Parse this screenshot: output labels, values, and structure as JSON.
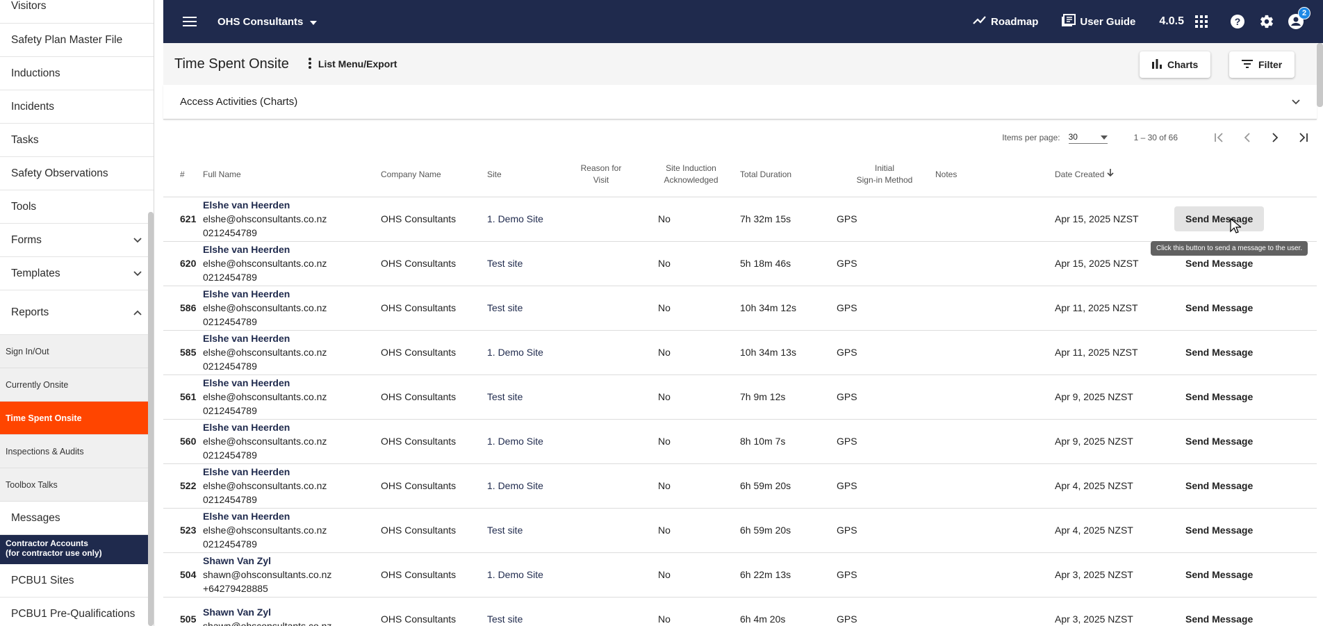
{
  "sidebar": {
    "items": [
      {
        "label": "Visitors"
      },
      {
        "label": "Safety Plan Master File"
      },
      {
        "label": "Inductions"
      },
      {
        "label": "Incidents"
      },
      {
        "label": "Tasks"
      },
      {
        "label": "Safety Observations"
      },
      {
        "label": "Tools"
      },
      {
        "label": "Forms"
      },
      {
        "label": "Templates"
      },
      {
        "label": "Reports"
      }
    ],
    "reports_sub": [
      {
        "label": "Sign In/Out"
      },
      {
        "label": "Currently Onsite"
      },
      {
        "label": "Time Spent Onsite"
      },
      {
        "label": "Inspections & Audits"
      },
      {
        "label": "Toolbox Talks"
      }
    ],
    "messages": "Messages",
    "contractor_banner_line1": "Contractor Accounts",
    "contractor_banner_line2": "(for contractor use only)",
    "contractor_items": [
      {
        "label": "PCBU1 Sites"
      },
      {
        "label": "PCBU1 Pre-Qualifications"
      }
    ]
  },
  "topbar": {
    "org_name": "OHS Consultants",
    "roadmap": "Roadmap",
    "user_guide": "User Guide",
    "version": "4.0.5",
    "notification_count": "2",
    "colors": {
      "bar": "#1f2a4d",
      "badge": "#1e88e5"
    }
  },
  "page": {
    "title": "Time Spent Onsite",
    "list_menu": "List Menu/Export",
    "charts_btn": "Charts",
    "filter_btn": "Filter",
    "accordion": "Access Activities (Charts)"
  },
  "paginator": {
    "items_per_page_label": "Items per page:",
    "items_per_page": "30",
    "range": "1 – 30 of 66"
  },
  "table": {
    "headers": {
      "num": "#",
      "full_name": "Full Name",
      "company": "Company Name",
      "site": "Site",
      "reason_1": "Reason for",
      "reason_2": "Visit",
      "induction_1": "Site Induction",
      "induction_2": "Acknowledged",
      "duration": "Total Duration",
      "signin_1": "Initial",
      "signin_2": "Sign-in Method",
      "notes": "Notes",
      "date": "Date Created"
    },
    "send_label": "Send Message",
    "rows": [
      {
        "id": "621",
        "name": "Elshe van Heerden",
        "email": "elshe@ohsconsultants.co.nz",
        "phone": "0212454789",
        "company": "OHS Consultants",
        "site": "1. Demo Site",
        "reason": "",
        "induction": "No",
        "duration": "7h 32m 15s",
        "method": "GPS",
        "notes": "",
        "date": "Apr 15, 2025 NZST"
      },
      {
        "id": "620",
        "name": "Elshe van Heerden",
        "email": "elshe@ohsconsultants.co.nz",
        "phone": "0212454789",
        "company": "OHS Consultants",
        "site": "Test site",
        "reason": "",
        "induction": "No",
        "duration": "5h 18m 46s",
        "method": "GPS",
        "notes": "",
        "date": "Apr 15, 2025 NZST"
      },
      {
        "id": "586",
        "name": "Elshe van Heerden",
        "email": "elshe@ohsconsultants.co.nz",
        "phone": "0212454789",
        "company": "OHS Consultants",
        "site": "Test site",
        "reason": "",
        "induction": "No",
        "duration": "10h 34m 12s",
        "method": "GPS",
        "notes": "",
        "date": "Apr 11, 2025 NZST"
      },
      {
        "id": "585",
        "name": "Elshe van Heerden",
        "email": "elshe@ohsconsultants.co.nz",
        "phone": "0212454789",
        "company": "OHS Consultants",
        "site": "1. Demo Site",
        "reason": "",
        "induction": "No",
        "duration": "10h 34m 13s",
        "method": "GPS",
        "notes": "",
        "date": "Apr 11, 2025 NZST"
      },
      {
        "id": "561",
        "name": "Elshe van Heerden",
        "email": "elshe@ohsconsultants.co.nz",
        "phone": "0212454789",
        "company": "OHS Consultants",
        "site": "Test site",
        "reason": "",
        "induction": "No",
        "duration": "7h 9m 12s",
        "method": "GPS",
        "notes": "",
        "date": "Apr 9, 2025 NZST"
      },
      {
        "id": "560",
        "name": "Elshe van Heerden",
        "email": "elshe@ohsconsultants.co.nz",
        "phone": "0212454789",
        "company": "OHS Consultants",
        "site": "1. Demo Site",
        "reason": "",
        "induction": "No",
        "duration": "8h 10m 7s",
        "method": "GPS",
        "notes": "",
        "date": "Apr 9, 2025 NZST"
      },
      {
        "id": "522",
        "name": "Elshe van Heerden",
        "email": "elshe@ohsconsultants.co.nz",
        "phone": "0212454789",
        "company": "OHS Consultants",
        "site": "1. Demo Site",
        "reason": "",
        "induction": "No",
        "duration": "6h 59m 20s",
        "method": "GPS",
        "notes": "",
        "date": "Apr 4, 2025 NZST"
      },
      {
        "id": "523",
        "name": "Elshe van Heerden",
        "email": "elshe@ohsconsultants.co.nz",
        "phone": "0212454789",
        "company": "OHS Consultants",
        "site": "Test site",
        "reason": "",
        "induction": "No",
        "duration": "6h 59m 20s",
        "method": "GPS",
        "notes": "",
        "date": "Apr 4, 2025 NZST"
      },
      {
        "id": "504",
        "name": "Shawn Van Zyl",
        "email": "shawn@ohsconsultants.co.nz",
        "phone": "+64279428885",
        "company": "OHS Consultants",
        "site": "1. Demo Site",
        "reason": "",
        "induction": "No",
        "duration": "6h 22m 13s",
        "method": "GPS",
        "notes": "",
        "date": "Apr 3, 2025 NZST"
      },
      {
        "id": "505",
        "name": "Shawn Van Zyl",
        "email": "shawn@ohsconsultants.co.nz",
        "phone": "",
        "company": "OHS Consultants",
        "site": "Test site",
        "reason": "",
        "induction": "No",
        "duration": "6h 4m 20s",
        "method": "GPS",
        "notes": "",
        "date": "Apr 3, 2025 NZST"
      }
    ]
  },
  "tooltip": "Click this button to send a message to the user.",
  "colors": {
    "active_nav": "#ff4500",
    "navy": "#1f2a4d"
  }
}
